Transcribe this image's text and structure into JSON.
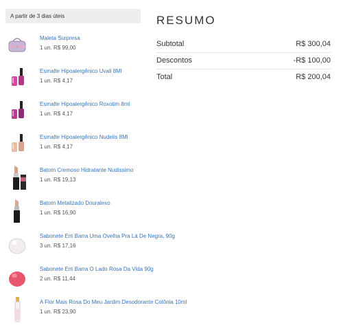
{
  "delivery": {
    "label": "A partir de 3 dias úteis"
  },
  "items": [
    {
      "name": "Maleta Surpresa",
      "qty": "1 un. R$ 99,00",
      "icon": "cosmetic-bag-icon"
    },
    {
      "name": "Esmalte Hipoalergênico Uvali 8Ml",
      "qty": "1 un. R$ 4,17",
      "icon": "nail-polish-icon"
    },
    {
      "name": "Esmalte Hipoalergênico Roxotim 8ml",
      "qty": "1 un. R$ 4,17",
      "icon": "nail-polish-icon"
    },
    {
      "name": "Esmalte Hipoalergênico Nudelis 8Ml",
      "qty": "1 un. R$ 4,17",
      "icon": "nail-polish-icon"
    },
    {
      "name": "Batom Cremoso Hidratante Nudissimo",
      "qty": "1 un. R$ 19,13",
      "icon": "lipstick-icon"
    },
    {
      "name": "Batom Metalizado Douralexo",
      "qty": "1 un. R$ 16,90",
      "icon": "lipstick-icon"
    },
    {
      "name": "Sabonete Em Barra Uma Ovelha Pra Lá De Negra, 90g",
      "qty": "3 un. R$ 17,16",
      "icon": "soap-bar-icon"
    },
    {
      "name": "Sabonete Em Barra O Lado Rosa Da Vida 90g",
      "qty": "2 un. R$ 11,44",
      "icon": "soap-bar-icon"
    },
    {
      "name": "A Flor Mais Rosa Do Meu Jardim Desodorante Colônia 10ml",
      "qty": "1 un. R$ 23,90",
      "icon": "perfume-vial-icon"
    }
  ],
  "summary": {
    "title": "RESUMO",
    "subtotal_label": "Subtotal",
    "subtotal_value": "R$ 300,04",
    "discount_label": "Descontos",
    "discount_value": "-R$ 100,00",
    "total_label": "Total",
    "total_value": "R$ 200,04"
  }
}
